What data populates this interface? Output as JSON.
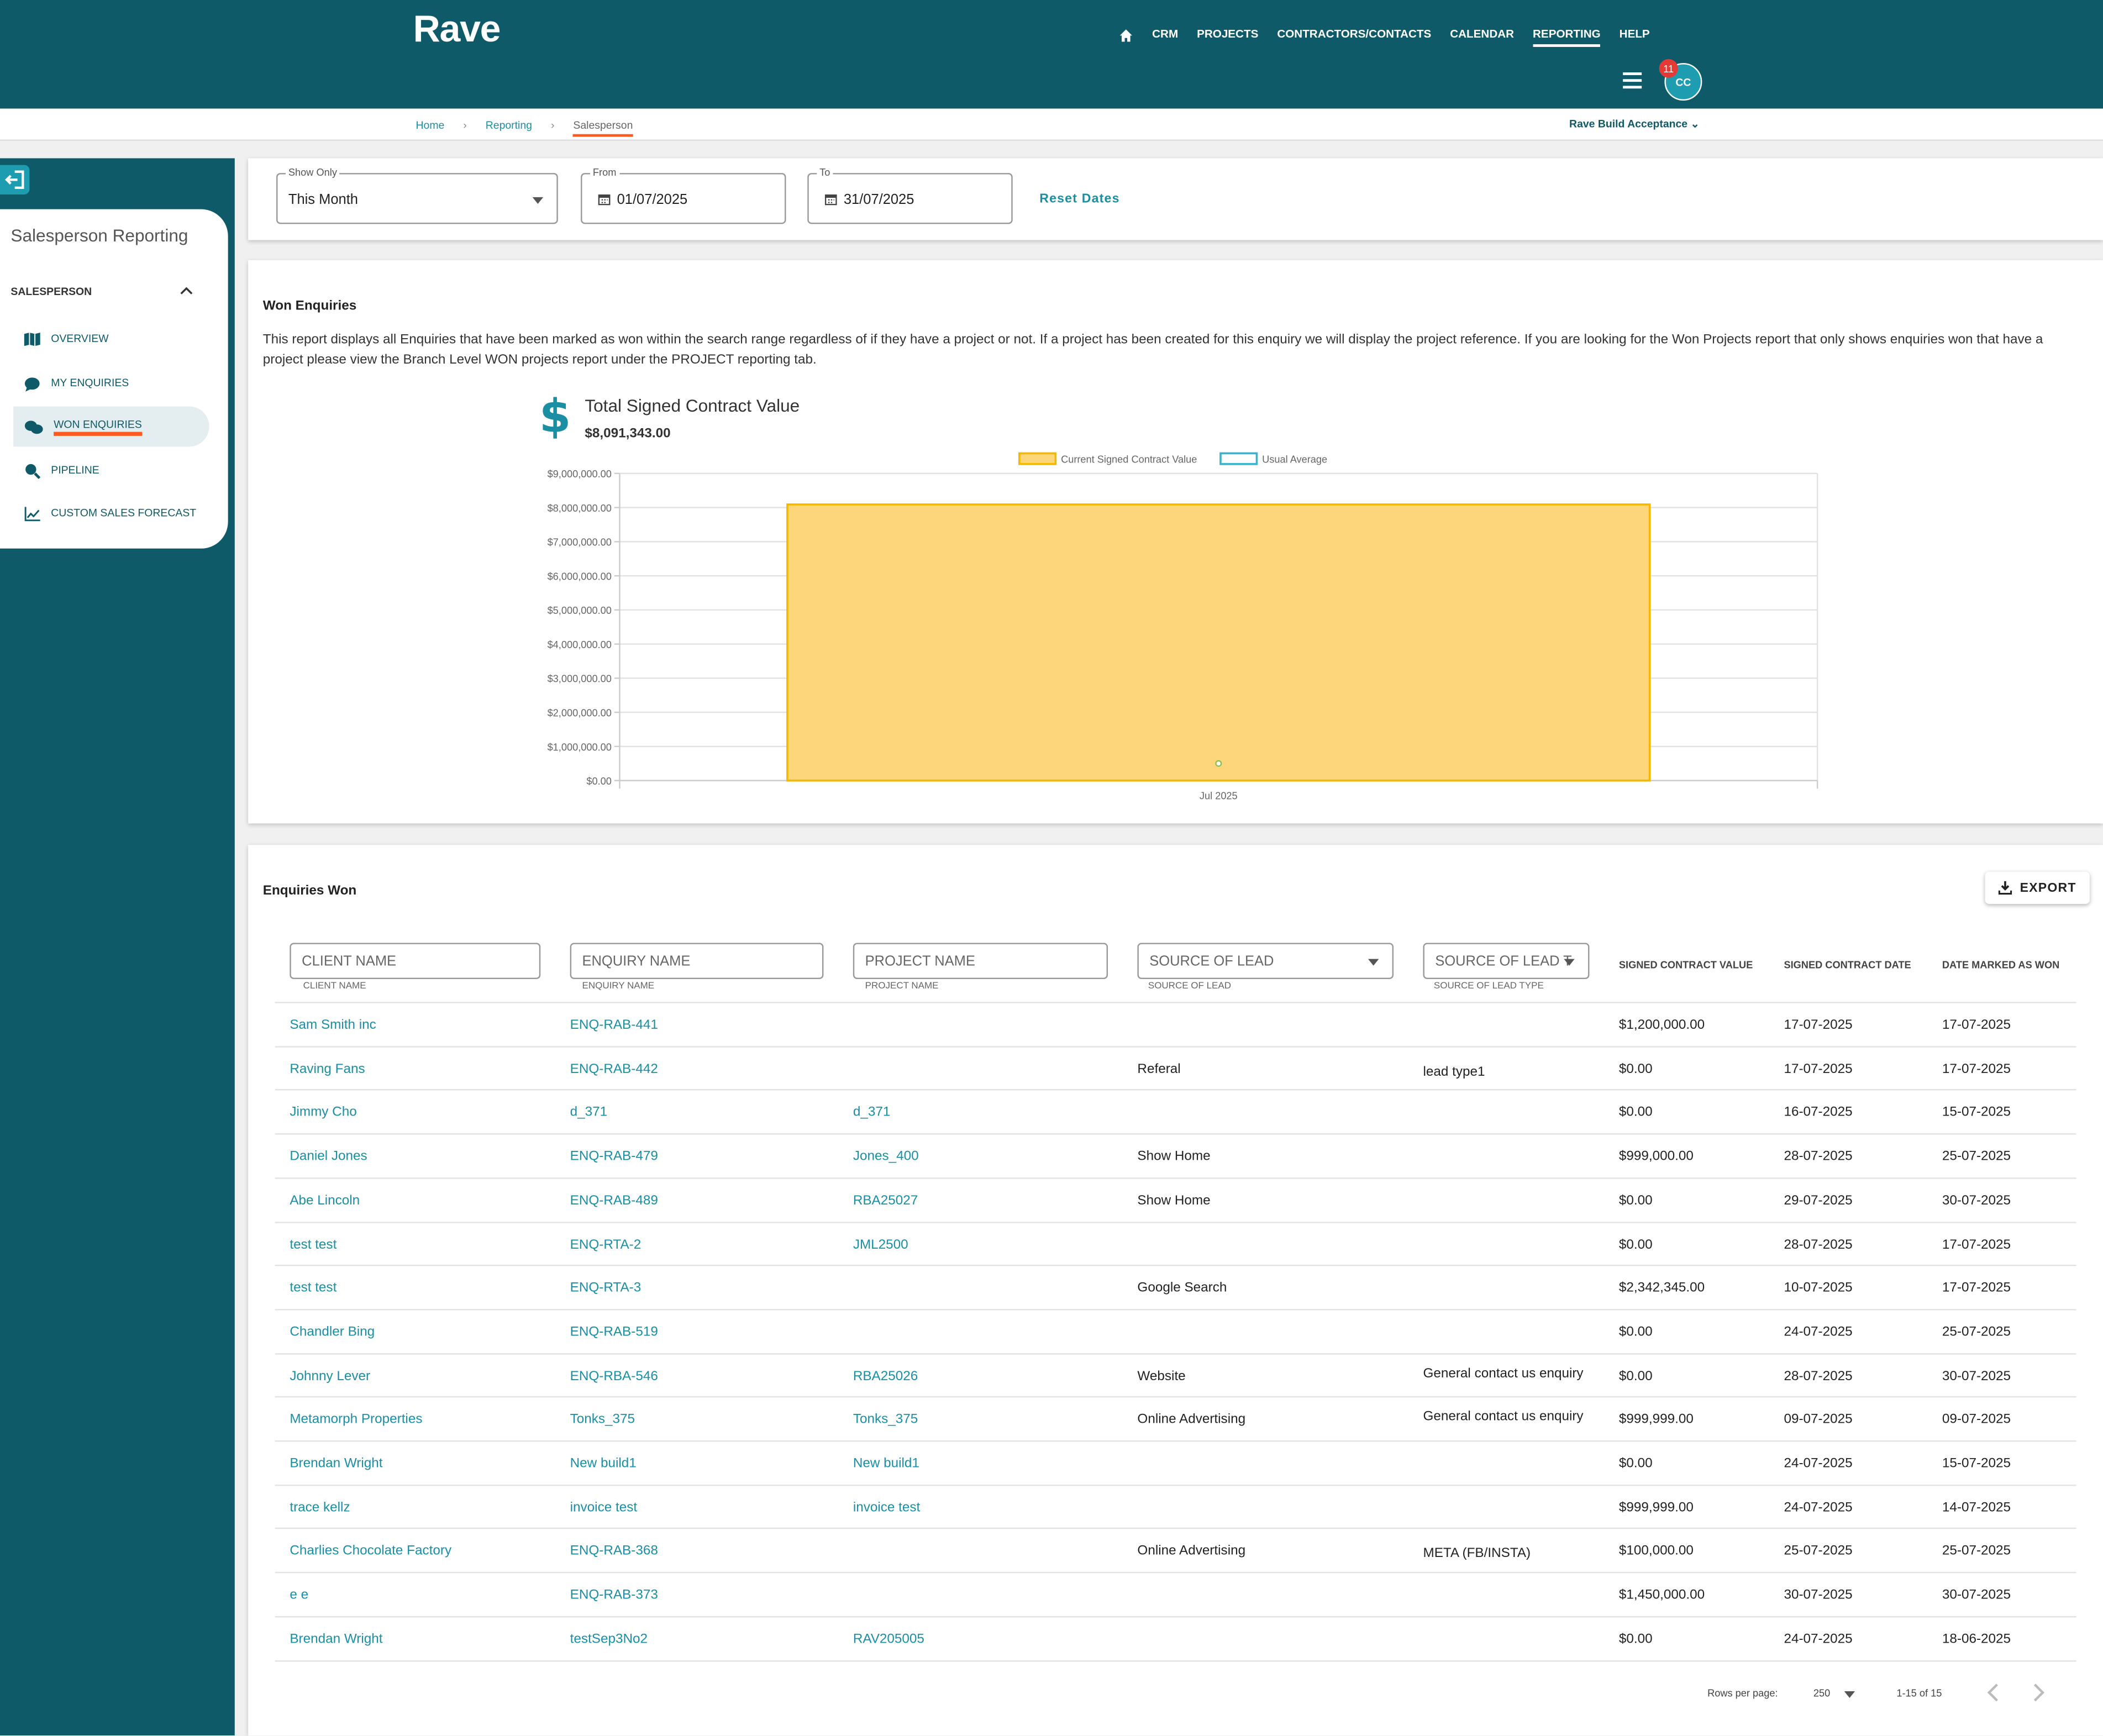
{
  "app": {
    "logo": "Rave"
  },
  "nav": {
    "items": [
      "CRM",
      "PROJECTS",
      "CONTRACTORS/CONTACTS",
      "CALENDAR",
      "REPORTING",
      "HELP"
    ],
    "active": "REPORTING",
    "notification_count": "11",
    "avatar_initials": "CC"
  },
  "breadcrumb": {
    "home": "Home",
    "section": "Reporting",
    "current": "Salesperson"
  },
  "company": "Rave Build Acceptance",
  "sidebar": {
    "title": "Salesperson Reporting",
    "group": "SALESPERSON",
    "items": [
      {
        "label": "OVERVIEW",
        "icon": "map-icon"
      },
      {
        "label": "MY ENQUIRIES",
        "icon": "chat-icon"
      },
      {
        "label": "WON ENQUIRIES",
        "icon": "chats-icon",
        "active": true
      },
      {
        "label": "PIPELINE",
        "icon": "search-icon"
      },
      {
        "label": "CUSTOM SALES FORECAST",
        "icon": "trend-icon"
      }
    ]
  },
  "filters": {
    "show_only_label": "Show Only",
    "show_only_value": "This Month",
    "from_label": "From",
    "from_value": "01/07/2025",
    "to_label": "To",
    "to_value": "31/07/2025",
    "reset_label": "Reset Dates"
  },
  "report": {
    "title": "Won Enquiries",
    "description": "This report displays all Enquiries that have been marked as won within the search range regardless of if they have a project or not. If a project has been created for this enquiry we will display the project reference. If you are looking for the Won Projects report that only shows enquiries won that have a project please view the Branch Level WON projects report under the PROJECT reporting tab.",
    "total_label": "Total Signed Contract Value",
    "total_value": "$8,091,343.00"
  },
  "chart_data": {
    "type": "bar",
    "categories": [
      "Jul 2025"
    ],
    "series": [
      {
        "name": "Current Signed Contract Value",
        "values": [
          8091343
        ],
        "color": "#fdd57a",
        "border": "#f5b800"
      },
      {
        "name": "Usual Average",
        "values": [
          500000
        ],
        "color": "#ffffff",
        "border": "#37b4cf"
      }
    ],
    "ylim": [
      0,
      9000000
    ],
    "yticks": [
      "$0.00",
      "$1,000,000.00",
      "$2,000,000.00",
      "$3,000,000.00",
      "$4,000,000.00",
      "$5,000,000.00",
      "$6,000,000.00",
      "$7,000,000.00",
      "$8,000,000.00",
      "$9,000,000.00"
    ],
    "grid": true,
    "legend": "top-center",
    "title": "",
    "xlabel": "",
    "ylabel": ""
  },
  "table": {
    "title": "Enquiries Won",
    "export_label": "EXPORT",
    "filters": [
      "CLIENT NAME",
      "ENQUIRY NAME",
      "PROJECT NAME",
      "SOURCE OF LEAD",
      "SOURCE OF LEAD T"
    ],
    "filter_labels": [
      "CLIENT NAME",
      "ENQUIRY NAME",
      "PROJECT NAME",
      "SOURCE OF LEAD",
      "SOURCE OF LEAD TYPE"
    ],
    "headers": [
      "SIGNED CONTRACT VALUE",
      "SIGNED CONTRACT DATE",
      "DATE MARKED AS WON"
    ],
    "rows": [
      [
        "Sam Smith inc",
        "ENQ-RAB-441",
        "",
        "",
        "",
        "$1,200,000.00",
        "17-07-2025",
        "17-07-2025"
      ],
      [
        "Raving Fans",
        "ENQ-RAB-442",
        "",
        "Referal",
        "lead type1",
        "$0.00",
        "17-07-2025",
        "17-07-2025"
      ],
      [
        "Jimmy Cho",
        "d_371",
        "d_371",
        "",
        "",
        "$0.00",
        "16-07-2025",
        "15-07-2025"
      ],
      [
        "Daniel Jones",
        "ENQ-RAB-479",
        "Jones_400",
        "Show Home",
        "",
        "$999,000.00",
        "28-07-2025",
        "25-07-2025"
      ],
      [
        "Abe Lincoln",
        "ENQ-RAB-489",
        "RBA25027",
        "Show Home",
        "",
        "$0.00",
        "29-07-2025",
        "30-07-2025"
      ],
      [
        "test test",
        "ENQ-RTA-2",
        "JML2500",
        "",
        "",
        "$0.00",
        "28-07-2025",
        "17-07-2025"
      ],
      [
        "test test",
        "ENQ-RTA-3",
        "",
        "Google Search",
        "",
        "$2,342,345.00",
        "10-07-2025",
        "17-07-2025"
      ],
      [
        "Chandler Bing",
        "ENQ-RAB-519",
        "",
        "",
        "",
        "$0.00",
        "24-07-2025",
        "25-07-2025"
      ],
      [
        "Johnny Lever",
        "ENQ-RBA-546",
        "RBA25026",
        "Website",
        "General contact us enquiry",
        "$0.00",
        "28-07-2025",
        "30-07-2025"
      ],
      [
        "Metamorph Properties",
        "Tonks_375",
        "Tonks_375",
        "Online Advertising",
        "General contact us enquiry",
        "$999,999.00",
        "09-07-2025",
        "09-07-2025"
      ],
      [
        "Brendan Wright",
        "New build1",
        "New build1",
        "",
        "",
        "$0.00",
        "24-07-2025",
        "15-07-2025"
      ],
      [
        "trace kellz",
        "invoice test",
        "invoice test",
        "",
        "",
        "$999,999.00",
        "24-07-2025",
        "14-07-2025"
      ],
      [
        "Charlies Chocolate Factory",
        "ENQ-RAB-368",
        "",
        "Online Advertising",
        "META (FB/INSTA)",
        "$100,000.00",
        "25-07-2025",
        "25-07-2025"
      ],
      [
        "e e",
        "ENQ-RAB-373",
        "",
        "",
        "",
        "$1,450,000.00",
        "30-07-2025",
        "30-07-2025"
      ],
      [
        "Brendan Wright",
        "testSep3No2",
        "RAV205005",
        "",
        "",
        "$0.00",
        "24-07-2025",
        "18-06-2025"
      ]
    ],
    "rows_per_page_label": "Rows per page:",
    "rows_per_page": "250",
    "range": "1-15 of 15"
  }
}
